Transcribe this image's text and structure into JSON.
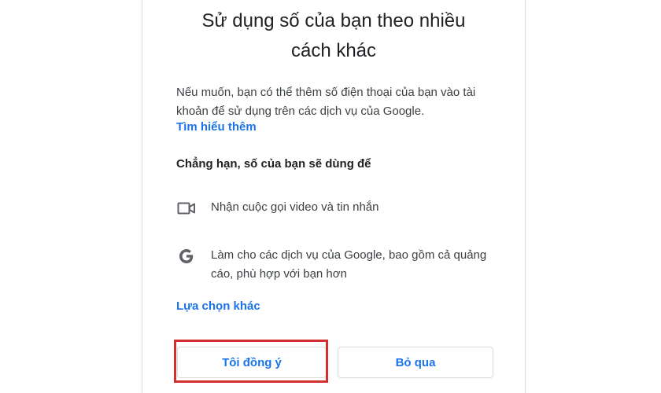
{
  "dialog": {
    "title_line1": "Sử dụng số của bạn theo nhiều",
    "title_line2": "cách khác",
    "description": "Nếu muốn, bạn có thể thêm số điện thoại của bạn vào tài khoản để sử dụng trên các dịch vụ của Google.",
    "learn_more": "Tìm hiểu thêm",
    "subheading": "Chẳng hạn, số của bạn sẽ dùng để",
    "features": [
      {
        "icon": "video-camera-icon",
        "text": "Nhận cuộc gọi video và tin nhắn"
      },
      {
        "icon": "google-logo-icon",
        "text": "Làm cho các dịch vụ của Google, bao gồm cả quảng cáo, phù hợp với bạn hơn"
      }
    ],
    "other_options": "Lựa chọn khác",
    "agree_button": "Tôi đồng ý",
    "skip_button": "Bỏ qua"
  },
  "colors": {
    "link": "#1a73e8",
    "text": "#3c4043",
    "heading": "#202124",
    "border": "#dadce0",
    "highlight": "#d32f2f"
  }
}
